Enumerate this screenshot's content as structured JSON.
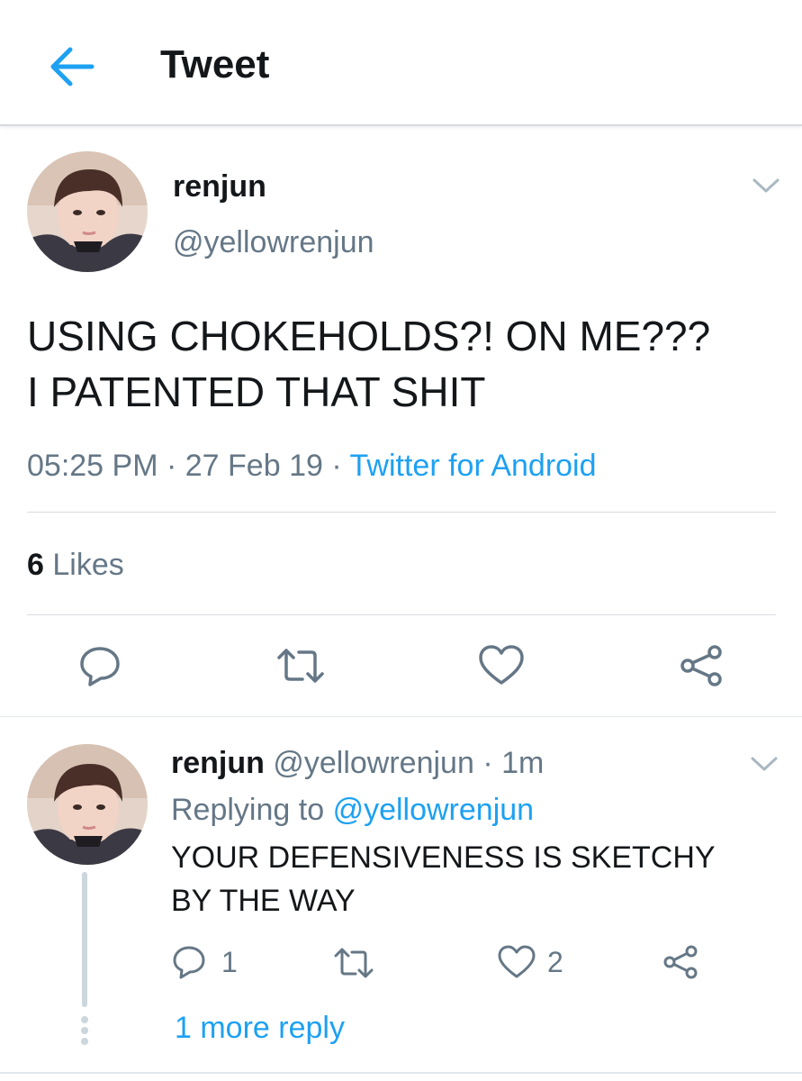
{
  "header": {
    "title": "Tweet"
  },
  "tweet": {
    "display_name": "renjun",
    "handle": "@yellowrenjun",
    "text_line1": "USING CHOKEHOLDS?! ON ME???",
    "text_line2": "I PATENTED THAT SHIT",
    "time": "05:25 PM",
    "sep1": "·",
    "date": "27 Feb 19",
    "sep2": "·",
    "source": "Twitter for Android",
    "likes_count": "6",
    "likes_label": "Likes"
  },
  "reply": {
    "display_name": "renjun",
    "handle": "@yellowrenjun",
    "sep": "·",
    "age": "1m",
    "replying_prefix": "Replying to",
    "replying_to": "@yellowrenjun",
    "text_line1": "YOUR DEFENSIVENESS IS SKETCHY",
    "text_line2": "BY THE WAY",
    "reply_count": "1",
    "like_count": "2",
    "more_replies": "1 more reply"
  },
  "colors": {
    "accent": "#1da1f2",
    "secondary_text": "#657786",
    "icon": "#657786",
    "thread_line": "#ccd6dd"
  },
  "icons": [
    "back-arrow-icon",
    "chevron-down-icon",
    "reply-icon",
    "retweet-icon",
    "like-icon",
    "share-icon"
  ]
}
